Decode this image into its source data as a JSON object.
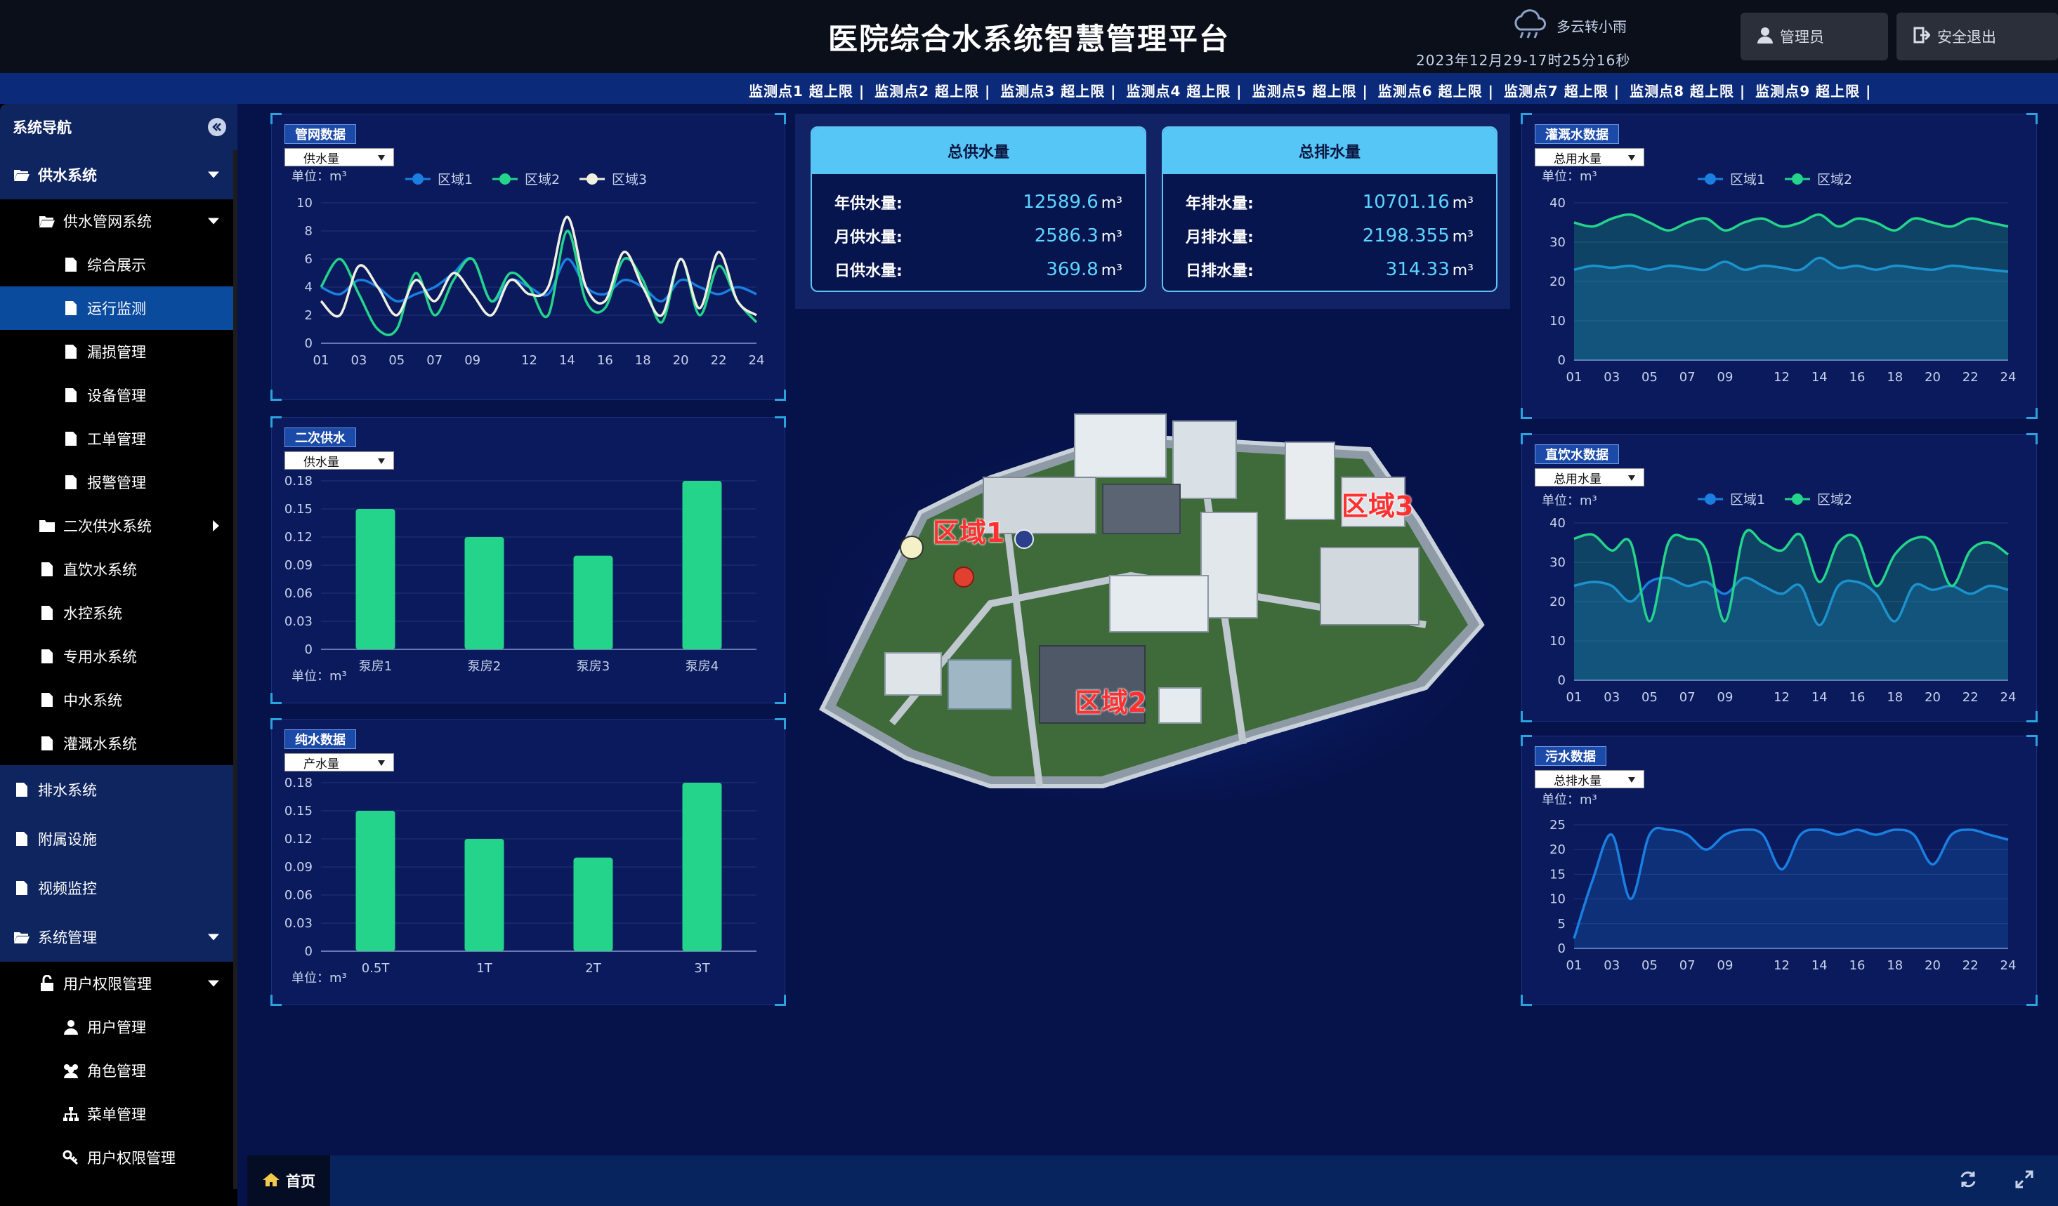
{
  "header": {
    "title": "医院综合水系统智慧管理平台",
    "weather": "多云转小雨",
    "datetime": "2023年12月29-17时25分16秒",
    "admin_label": "管理员",
    "logout_label": "安全退出"
  },
  "ticker": [
    "监测点1 超上限 |",
    "监测点2 超上限 |",
    "监测点3 超上限 |",
    "监测点4 超上限 |",
    "监测点5 超上限 |",
    "监测点6 超上限 |",
    "监测点7 超上限 |",
    "监测点8 超上限 |",
    "监测点9 超上限 |"
  ],
  "sidebar": {
    "title": "系统导航",
    "items": [
      {
        "label": "供水系统"
      },
      {
        "label": "供水管网系统"
      },
      {
        "label": "综合展示"
      },
      {
        "label": "运行监测"
      },
      {
        "label": "漏损管理"
      },
      {
        "label": "设备管理"
      },
      {
        "label": "工单管理"
      },
      {
        "label": "报警管理"
      },
      {
        "label": "二次供水系统"
      },
      {
        "label": "直饮水系统"
      },
      {
        "label": "水控系统"
      },
      {
        "label": "专用水系统"
      },
      {
        "label": "中水系统"
      },
      {
        "label": "灌溉水系统"
      },
      {
        "label": "排水系统"
      },
      {
        "label": "附属设施"
      },
      {
        "label": "视频监控"
      },
      {
        "label": "系统管理"
      },
      {
        "label": "用户权限管理"
      },
      {
        "label": "用户管理"
      },
      {
        "label": "角色管理"
      },
      {
        "label": "菜单管理"
      },
      {
        "label": "用户权限管理"
      }
    ]
  },
  "footer": {
    "home_label": "首页"
  },
  "panels": {
    "pipe": {
      "title": "管网数据",
      "select": "供水量",
      "unit": "单位：m³"
    },
    "secondary": {
      "title": "二次供水",
      "select": "供水量",
      "unit": "单位：m³"
    },
    "pure": {
      "title": "纯水数据",
      "select": "产水量",
      "unit": "单位：m³"
    },
    "irrigation": {
      "title": "灌溉水数据",
      "select": "总用水量",
      "unit": "单位：m³"
    },
    "direct": {
      "title": "直饮水数据",
      "select": "总用水量",
      "unit": "单位：m³"
    },
    "sewage": {
      "title": "污水数据",
      "select": "总排水量",
      "unit": "单位：m³"
    }
  },
  "stats": {
    "supply": {
      "title": "总供水量",
      "rows": [
        {
          "label": "年供水量:",
          "value": "12589.6",
          "unit": "m³"
        },
        {
          "label": "月供水量:",
          "value": "2586.3",
          "unit": "m³"
        },
        {
          "label": "日供水量:",
          "value": "369.8",
          "unit": "m³"
        }
      ]
    },
    "drain": {
      "title": "总排水量",
      "rows": [
        {
          "label": "年排水量:",
          "value": "10701.16",
          "unit": "m³"
        },
        {
          "label": "月排水量:",
          "value": "2198.355",
          "unit": "m³"
        },
        {
          "label": "日排水量:",
          "value": "314.33",
          "unit": "m³"
        }
      ]
    }
  },
  "map": {
    "zones": [
      "区域1",
      "区域2",
      "区域3"
    ]
  },
  "colors": {
    "series1": "#1a7fe0",
    "series2": "#23d48a",
    "series3": "#f0f0e0",
    "bar": "#23d48a",
    "accent": "#56c6f7"
  },
  "chart_data": [
    {
      "id": "pipe",
      "type": "line",
      "x": [
        "01",
        "02",
        "03",
        "04",
        "05",
        "06",
        "07",
        "08",
        "09",
        "10",
        "11",
        "12",
        "13",
        "14",
        "15",
        "16",
        "17",
        "18",
        "19",
        "20",
        "21",
        "22",
        "23",
        "24"
      ],
      "xticks": [
        "01",
        "03",
        "05",
        "07",
        "09",
        "12",
        "14",
        "16",
        "18",
        "20",
        "22",
        "24"
      ],
      "ylim": [
        0,
        10
      ],
      "yticks": [
        0,
        2,
        4,
        6,
        8,
        10
      ],
      "legend": "top",
      "series": [
        {
          "name": "区域1",
          "color": "#1a7fe0",
          "values": [
            4,
            3.5,
            4.5,
            4,
            3,
            3.5,
            4,
            5,
            6,
            3,
            4.5,
            4,
            3.5,
            6,
            4,
            3.5,
            4.5,
            4,
            3,
            4.5,
            4,
            3.5,
            4,
            3.5
          ]
        },
        {
          "name": "区域2",
          "color": "#23d48a",
          "values": [
            4,
            6,
            3.5,
            1,
            1,
            5,
            2,
            4.5,
            6,
            3,
            5,
            4,
            2,
            8,
            3,
            2.5,
            6,
            4.5,
            1.5,
            6,
            2,
            5.5,
            3,
            1.5
          ]
        },
        {
          "name": "区域3",
          "color": "#f0f0e0",
          "values": [
            3,
            2,
            5.5,
            4,
            2,
            4.5,
            3,
            5,
            3.5,
            2,
            4.5,
            3.5,
            4,
            9,
            4,
            3,
            6.5,
            4,
            2,
            6,
            2.5,
            6.5,
            3,
            2
          ]
        }
      ]
    },
    {
      "id": "secondary",
      "type": "bar",
      "categories": [
        "泵房1",
        "泵房2",
        "泵房3",
        "泵房4"
      ],
      "values": [
        0.15,
        0.12,
        0.1,
        0.18
      ],
      "ylim": [
        0,
        0.18
      ],
      "yticks": [
        0,
        0.03,
        0.06,
        0.09,
        0.12,
        0.15,
        0.18
      ]
    },
    {
      "id": "pure",
      "type": "bar",
      "categories": [
        "0.5T",
        "1T",
        "2T",
        "3T"
      ],
      "values": [
        0.15,
        0.12,
        0.1,
        0.18
      ],
      "ylim": [
        0,
        0.18
      ],
      "yticks": [
        0,
        0.03,
        0.06,
        0.09,
        0.12,
        0.15,
        0.18
      ]
    },
    {
      "id": "irrigation",
      "type": "area",
      "x": [
        "01",
        "02",
        "03",
        "04",
        "05",
        "06",
        "07",
        "08",
        "09",
        "10",
        "11",
        "12",
        "13",
        "14",
        "15",
        "16",
        "17",
        "18",
        "19",
        "20",
        "21",
        "22",
        "23",
        "24"
      ],
      "xticks": [
        "01",
        "03",
        "05",
        "07",
        "09",
        "12",
        "14",
        "16",
        "18",
        "20",
        "22",
        "24"
      ],
      "ylim": [
        0,
        40
      ],
      "yticks": [
        0,
        10,
        20,
        30,
        40
      ],
      "legend": "top",
      "series": [
        {
          "name": "区域1",
          "color": "#1a7fe0",
          "values": [
            23,
            24,
            23.5,
            24,
            23,
            24,
            23.5,
            23,
            25,
            23,
            24,
            23.5,
            23,
            26,
            23.5,
            24,
            23,
            24,
            23.5,
            23,
            24,
            23.5,
            23,
            22.5
          ]
        },
        {
          "name": "区域2",
          "color": "#23d48a",
          "values": [
            35,
            34,
            36,
            37,
            35,
            33,
            35,
            36,
            33,
            35,
            36,
            34,
            35,
            37,
            34,
            36,
            35,
            33,
            36,
            35,
            34,
            36,
            35,
            34
          ]
        }
      ]
    },
    {
      "id": "direct",
      "type": "area",
      "x": [
        "01",
        "02",
        "03",
        "04",
        "05",
        "06",
        "07",
        "08",
        "09",
        "10",
        "11",
        "12",
        "13",
        "14",
        "15",
        "16",
        "17",
        "18",
        "19",
        "20",
        "21",
        "22",
        "23",
        "24"
      ],
      "xticks": [
        "01",
        "03",
        "05",
        "07",
        "09",
        "12",
        "14",
        "16",
        "18",
        "20",
        "22",
        "24"
      ],
      "ylim": [
        0,
        40
      ],
      "yticks": [
        0,
        10,
        20,
        30,
        40
      ],
      "legend": "top",
      "series": [
        {
          "name": "区域1",
          "color": "#1a7fe0",
          "values": [
            24,
            25,
            24,
            20,
            25,
            26,
            24,
            25,
            22,
            26,
            24,
            22,
            24,
            14,
            24,
            25,
            22,
            15,
            24,
            23,
            24,
            22,
            24,
            23
          ]
        },
        {
          "name": "区域2",
          "color": "#23d48a",
          "values": [
            36,
            37,
            33,
            35,
            15,
            35,
            36,
            33,
            15,
            37,
            35,
            33,
            37,
            25,
            35,
            36,
            24,
            32,
            36,
            35,
            24,
            33,
            35,
            32
          ]
        }
      ]
    },
    {
      "id": "sewage",
      "type": "area",
      "x": [
        "01",
        "02",
        "03",
        "04",
        "05",
        "06",
        "07",
        "08",
        "09",
        "10",
        "11",
        "12",
        "13",
        "14",
        "15",
        "16",
        "17",
        "18",
        "19",
        "20",
        "21",
        "22",
        "23",
        "24"
      ],
      "xticks": [
        "01",
        "03",
        "05",
        "07",
        "09",
        "12",
        "14",
        "16",
        "18",
        "20",
        "22",
        "24"
      ],
      "ylim": [
        0,
        25
      ],
      "yticks": [
        0,
        5,
        10,
        15,
        20,
        25
      ],
      "series": [
        {
          "name": "",
          "color": "#1a7fe0",
          "values": [
            2,
            14,
            23,
            10,
            23,
            24,
            23,
            20,
            23,
            24,
            23,
            16,
            23,
            24,
            23,
            24,
            23,
            24,
            23,
            17,
            23,
            24,
            23,
            22
          ]
        }
      ]
    }
  ]
}
